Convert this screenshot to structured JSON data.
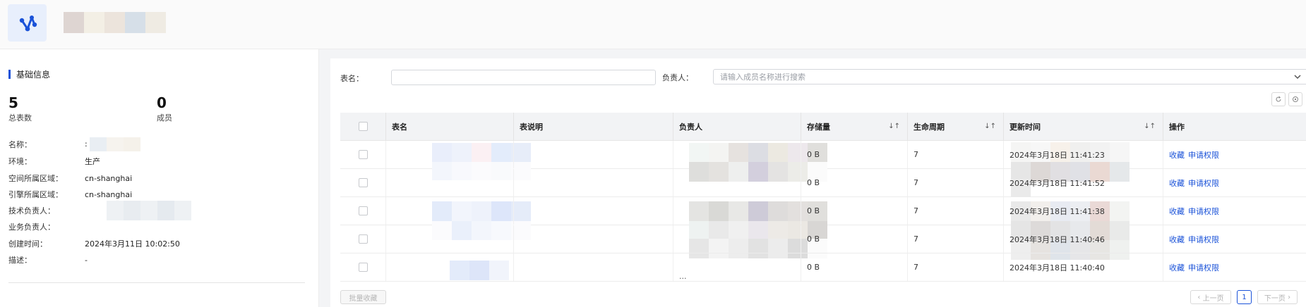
{
  "header": {
    "logo_icon": "share-nodes-icon",
    "accent": "#1a52d8"
  },
  "info": {
    "section_title": "基础信息",
    "stats": [
      {
        "value": "5",
        "label": "总表数"
      },
      {
        "value": "0",
        "label": "成员"
      }
    ],
    "fields": [
      {
        "key": "名称：",
        "value": ":"
      },
      {
        "key": "环境：",
        "value": "生产"
      },
      {
        "key": "空间所属区域：",
        "value": "cn-shanghai"
      },
      {
        "key": "引擎所属区域：",
        "value": "cn-shanghai"
      },
      {
        "key": "技术负责人：",
        "value": ""
      },
      {
        "key": "业务负责人：",
        "value": ""
      },
      {
        "key": "创建时间：",
        "value": "2024年3月11日 10:02:50"
      },
      {
        "key": "描述：",
        "value": "-"
      }
    ]
  },
  "filters": {
    "table_name_label": "表名：",
    "table_name_value": "",
    "owner_label": "负责人：",
    "owner_placeholder": "请输入成员名称进行搜索"
  },
  "toolbar": {
    "refresh_icon": "refresh-icon",
    "settings_icon": "settings-icon"
  },
  "table": {
    "columns": [
      "表名",
      "表说明",
      "负责人",
      "存储量",
      "生命周期",
      "更新时间",
      "操作"
    ],
    "rows": [
      {
        "size": "0 B",
        "lifecycle": "7",
        "updated": "2024年3月18日 11:41:23"
      },
      {
        "size": "0 B",
        "lifecycle": "7",
        "updated": "2024年3月18日 11:41:52"
      },
      {
        "size": "0 B",
        "lifecycle": "7",
        "updated": "2024年3月18日 11:41:38"
      },
      {
        "size": "0 B",
        "lifecycle": "7",
        "updated": "2024年3月18日 11:40:46"
      },
      {
        "size": "0 B",
        "lifecycle": "7",
        "updated": "2024年3月18日 11:40:40"
      }
    ],
    "actions": {
      "favorite": "收藏",
      "request": "申请权限"
    },
    "owner_overflow": "..."
  },
  "footer": {
    "batch_favorite": "批量收藏",
    "prev": "上一页",
    "page": "1",
    "next": "下一页"
  }
}
